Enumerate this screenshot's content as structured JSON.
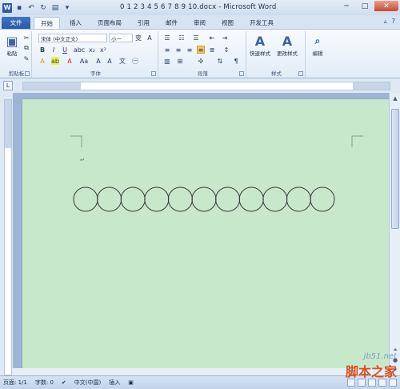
{
  "window": {
    "title": "0 1 2 3 4 5 6 7 8 9 10.docx - Microsoft Word",
    "minimize": "─",
    "maximize": "□",
    "close": "✕"
  },
  "tabs": [
    {
      "label": "文件"
    },
    {
      "label": "开始"
    },
    {
      "label": "插入"
    },
    {
      "label": "页面布局"
    },
    {
      "label": "引用"
    },
    {
      "label": "邮件"
    },
    {
      "label": "审阅"
    },
    {
      "label": "视图"
    },
    {
      "label": "开发工具"
    }
  ],
  "ribbon": {
    "clipboard": {
      "paste_label": "粘贴",
      "group_label": "剪贴板"
    },
    "font": {
      "font_name": "宋体 (中文正文)",
      "font_size": "小一",
      "group_label": "字体"
    },
    "paragraph": {
      "group_label": "段落"
    },
    "styles": {
      "quick_styles": "快速样式",
      "change_styles": "更改样式",
      "group_label": "样式"
    },
    "editing": {
      "label": "编辑"
    }
  },
  "document": {
    "circles": [
      {
        "label": "circle-1"
      },
      {
        "label": "circle-2"
      },
      {
        "label": "circle-3"
      },
      {
        "label": "circle-4"
      },
      {
        "label": "circle-5"
      },
      {
        "label": "circle-6"
      },
      {
        "label": "circle-7"
      },
      {
        "label": "circle-8"
      },
      {
        "label": "circle-9"
      },
      {
        "label": "circle-10"
      },
      {
        "label": "circle-11"
      }
    ]
  },
  "status": {
    "page": "页面: 1/1",
    "words": "字数: 0",
    "language": "中文(中国)",
    "mode": "插入"
  },
  "watermark": {
    "url": "jb51.net",
    "name": "脚本之家"
  },
  "colors": {
    "page_bg": "#c8e8cb",
    "ribbon_accent": "#2a5aa6"
  }
}
